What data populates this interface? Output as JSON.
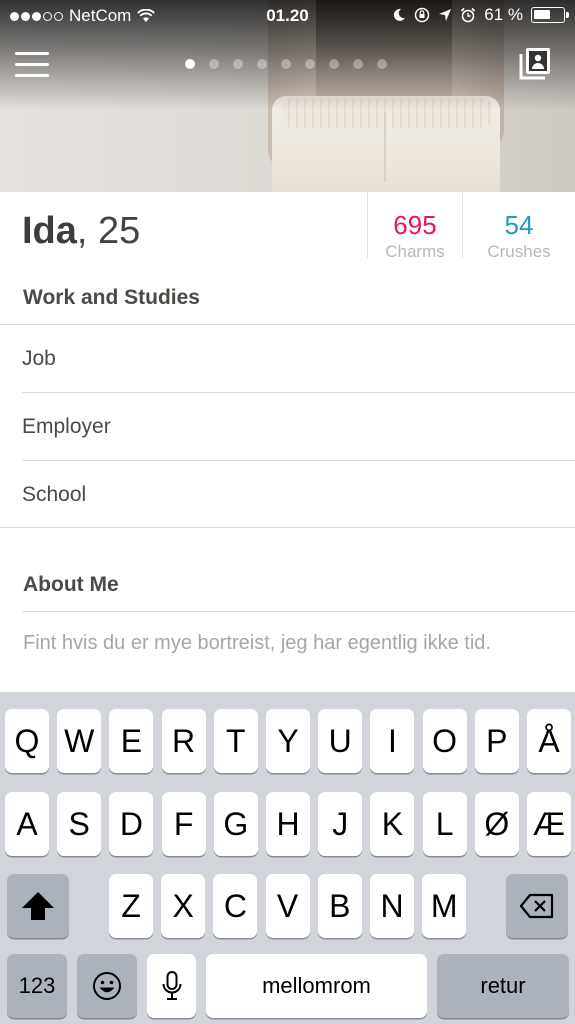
{
  "status_bar": {
    "carrier": "NetCom",
    "time": "01.20",
    "battery": "61 %",
    "battery_level": 0.61
  },
  "photo_carousel": {
    "count": 9,
    "active_index": 0
  },
  "profile": {
    "name": "Ida",
    "age_text": ", 25",
    "charms": {
      "value": "695",
      "label": "Charms",
      "color": "#e8175d"
    },
    "crushes": {
      "value": "54",
      "label": "Crushes",
      "color": "#1f9bc7"
    }
  },
  "work": {
    "title": "Work and Studies",
    "fields": [
      "Job",
      "Employer",
      "School"
    ]
  },
  "about": {
    "title": "About Me",
    "text": "Fint hvis du er mye bortreist, jeg har egentlig ikke tid."
  },
  "keyboard": {
    "row1": [
      "Q",
      "W",
      "E",
      "R",
      "T",
      "Y",
      "U",
      "I",
      "O",
      "P",
      "Å"
    ],
    "row2": [
      "A",
      "S",
      "D",
      "F",
      "G",
      "H",
      "J",
      "K",
      "L",
      "Ø",
      "Æ"
    ],
    "row3": [
      "Z",
      "X",
      "C",
      "V",
      "B",
      "N",
      "M"
    ],
    "numbers_label": "123",
    "space_label": "mellomrom",
    "return_label": "retur"
  }
}
